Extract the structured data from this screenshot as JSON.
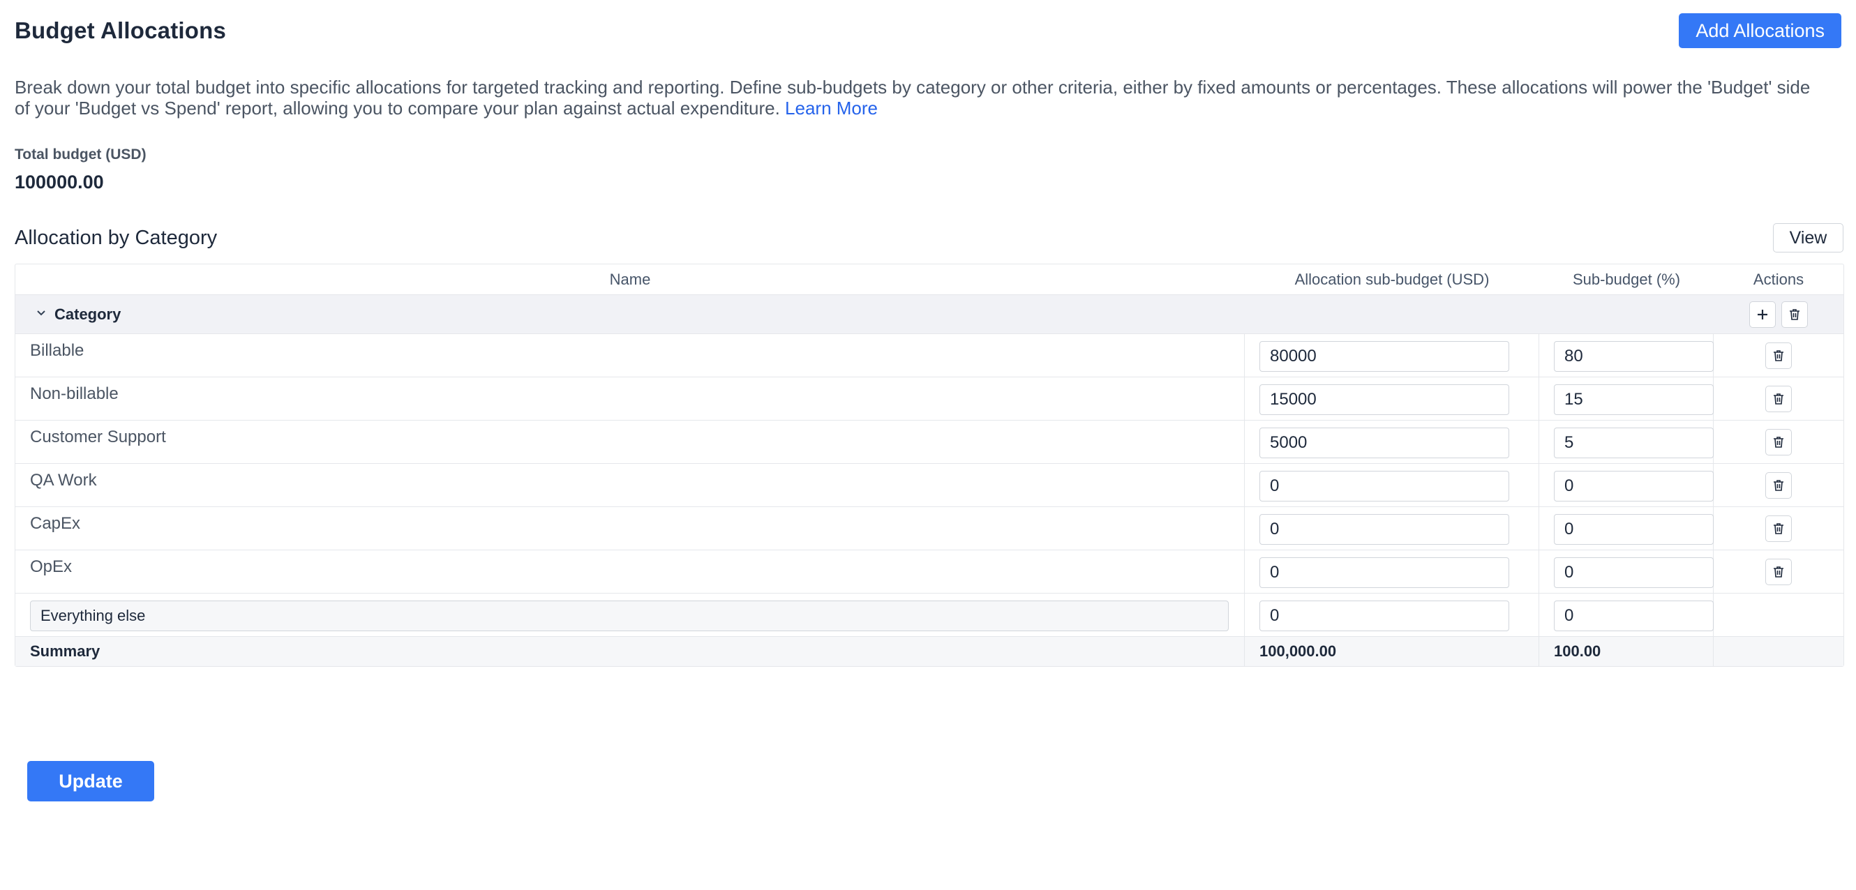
{
  "header": {
    "title": "Budget Allocations",
    "add_label": "Add Allocations"
  },
  "description": {
    "text": "Break down your total budget into specific allocations for targeted tracking and reporting. Define sub-budgets by category or other criteria, either by fixed amounts or percentages. These allocations will power the 'Budget' side of your 'Budget vs Spend' report, allowing you to compare your plan against actual expenditure.",
    "link": "Learn More"
  },
  "total": {
    "label": "Total budget (USD)",
    "value": "100000.00"
  },
  "section": {
    "title": "Allocation by Category",
    "view_label": "View"
  },
  "table": {
    "columns": {
      "name": "Name",
      "alloc": "Allocation sub-budget (USD)",
      "pct": "Sub-budget (%)",
      "actions": "Actions"
    },
    "group": "Category",
    "rows": [
      {
        "name": "Billable",
        "alloc": "80000",
        "pct": "80"
      },
      {
        "name": "Non-billable",
        "alloc": "15000",
        "pct": "15"
      },
      {
        "name": "Customer Support",
        "alloc": "5000",
        "pct": "5"
      },
      {
        "name": "QA Work",
        "alloc": "0",
        "pct": "0"
      },
      {
        "name": "CapEx",
        "alloc": "0",
        "pct": "0"
      },
      {
        "name": "OpEx",
        "alloc": "0",
        "pct": "0"
      }
    ],
    "else_row": {
      "name": "Everything else",
      "alloc": "0",
      "pct": "0"
    },
    "summary": {
      "label": "Summary",
      "alloc": "100,000.00",
      "pct": "100.00"
    }
  },
  "footer": {
    "update_label": "Update"
  },
  "colors": {
    "accent": "#3478f6",
    "link": "#2563eb"
  },
  "icons": {
    "collapse": "chevron-down-icon",
    "add": "plus-icon",
    "delete": "trash-icon"
  }
}
